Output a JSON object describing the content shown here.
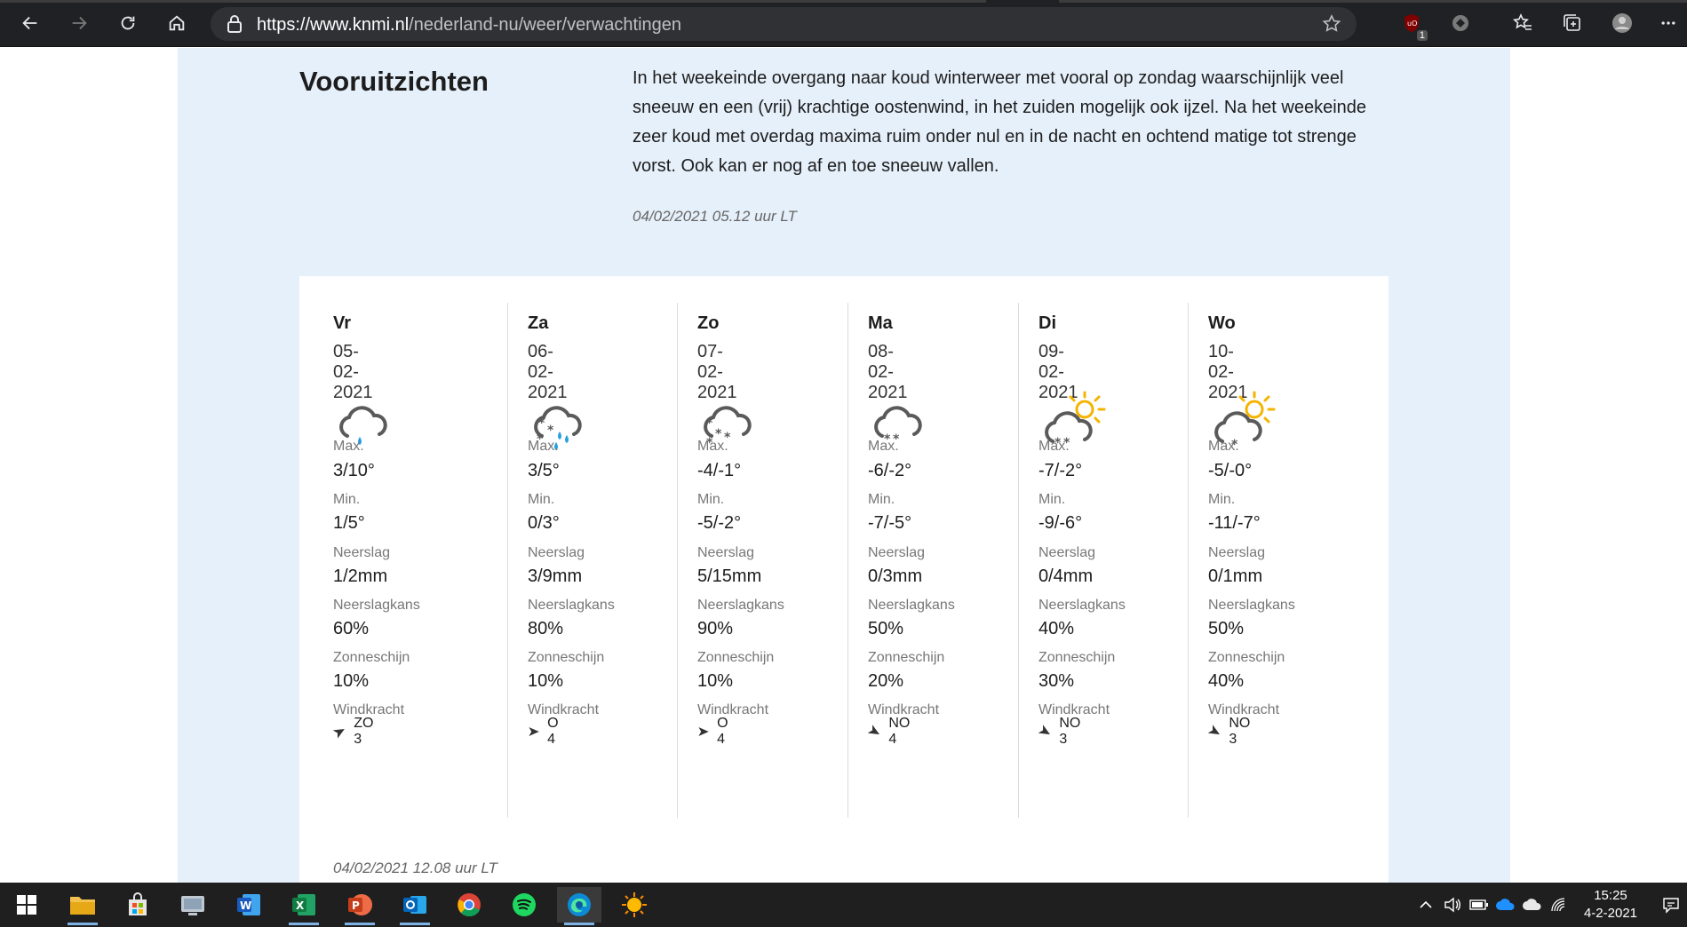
{
  "browser": {
    "url_scheme": "https://",
    "url_host": "www.knmi.nl",
    "url_path": "/nederland-nu/weer/verwachtingen",
    "extension_badge": "1"
  },
  "outlook": {
    "title": "Vooruitzichten",
    "text": "In het weekeinde overgang naar koud winterweer met vooral op zondag waarschijnlijk veel sneeuw en een (vrij) krachtige oostenwind, in het zuiden mogelijk ook ijzel. Na het weekeinde zeer koud met overdag maxima ruim onder nul en in de nacht en ochtend matige tot strenge vorst. Ook kan er nog af en toe sneeuw vallen.",
    "timestamp": "04/02/2021 05.12 uur LT"
  },
  "forecast": {
    "labels": {
      "max": "Max.",
      "min": "Min.",
      "precip": "Neerslag",
      "precip_chance": "Neerslagkans",
      "sunshine": "Zonneschijn",
      "wind": "Windkracht"
    },
    "days": [
      {
        "name": "Vr",
        "date": "05-02-2021",
        "icon": "cloud-rain-icon",
        "max": "3/10°",
        "min": "1/5°",
        "precip": "1/2mm",
        "chance": "60%",
        "sun": "10%",
        "wind": "ZO 3",
        "wind_dir": "ZO"
      },
      {
        "name": "Za",
        "date": "06-02-2021",
        "icon": "cloud-sleet-icon",
        "max": "3/5°",
        "min": "0/3°",
        "precip": "3/9mm",
        "chance": "80%",
        "sun": "10%",
        "wind": "O 4",
        "wind_dir": "O"
      },
      {
        "name": "Zo",
        "date": "07-02-2021",
        "icon": "cloud-snow-icon",
        "max": "-4/-1°",
        "min": "-5/-2°",
        "precip": "5/15mm",
        "chance": "90%",
        "sun": "10%",
        "wind": "O 4",
        "wind_dir": "O"
      },
      {
        "name": "Ma",
        "date": "08-02-2021",
        "icon": "cloud-light-snow-icon",
        "max": "-6/-2°",
        "min": "-7/-5°",
        "precip": "0/3mm",
        "chance": "50%",
        "sun": "20%",
        "wind": "NO 4",
        "wind_dir": "NO"
      },
      {
        "name": "Di",
        "date": "09-02-2021",
        "icon": "sun-cloud-snow-icon",
        "max": "-7/-2°",
        "min": "-9/-6°",
        "precip": "0/4mm",
        "chance": "40%",
        "sun": "30%",
        "wind": "NO 3",
        "wind_dir": "NO"
      },
      {
        "name": "Wo",
        "date": "10-02-2021",
        "icon": "sun-cloud-snowflake-icon",
        "max": "-5/-0°",
        "min": "-11/-7°",
        "precip": "0/1mm",
        "chance": "50%",
        "sun": "40%",
        "wind": "NO 3",
        "wind_dir": "NO"
      }
    ],
    "timestamp": "04/02/2021 12.08 uur LT"
  },
  "taskbar": {
    "apps": [
      "start-icon",
      "file-explorer-icon",
      "store-icon",
      "app-icon",
      "word-icon",
      "excel-icon",
      "powerpoint-icon",
      "outlook-icon",
      "chrome-icon",
      "spotify-icon",
      "edge-icon",
      "weather-app-icon"
    ],
    "time": "15:25",
    "date": "4-2-2021"
  },
  "colors": {
    "band": "#e6f0fa",
    "rain_drop": "#2aa0e0",
    "sun": "#f5b400",
    "icon_gray": "#5a5a5a"
  }
}
